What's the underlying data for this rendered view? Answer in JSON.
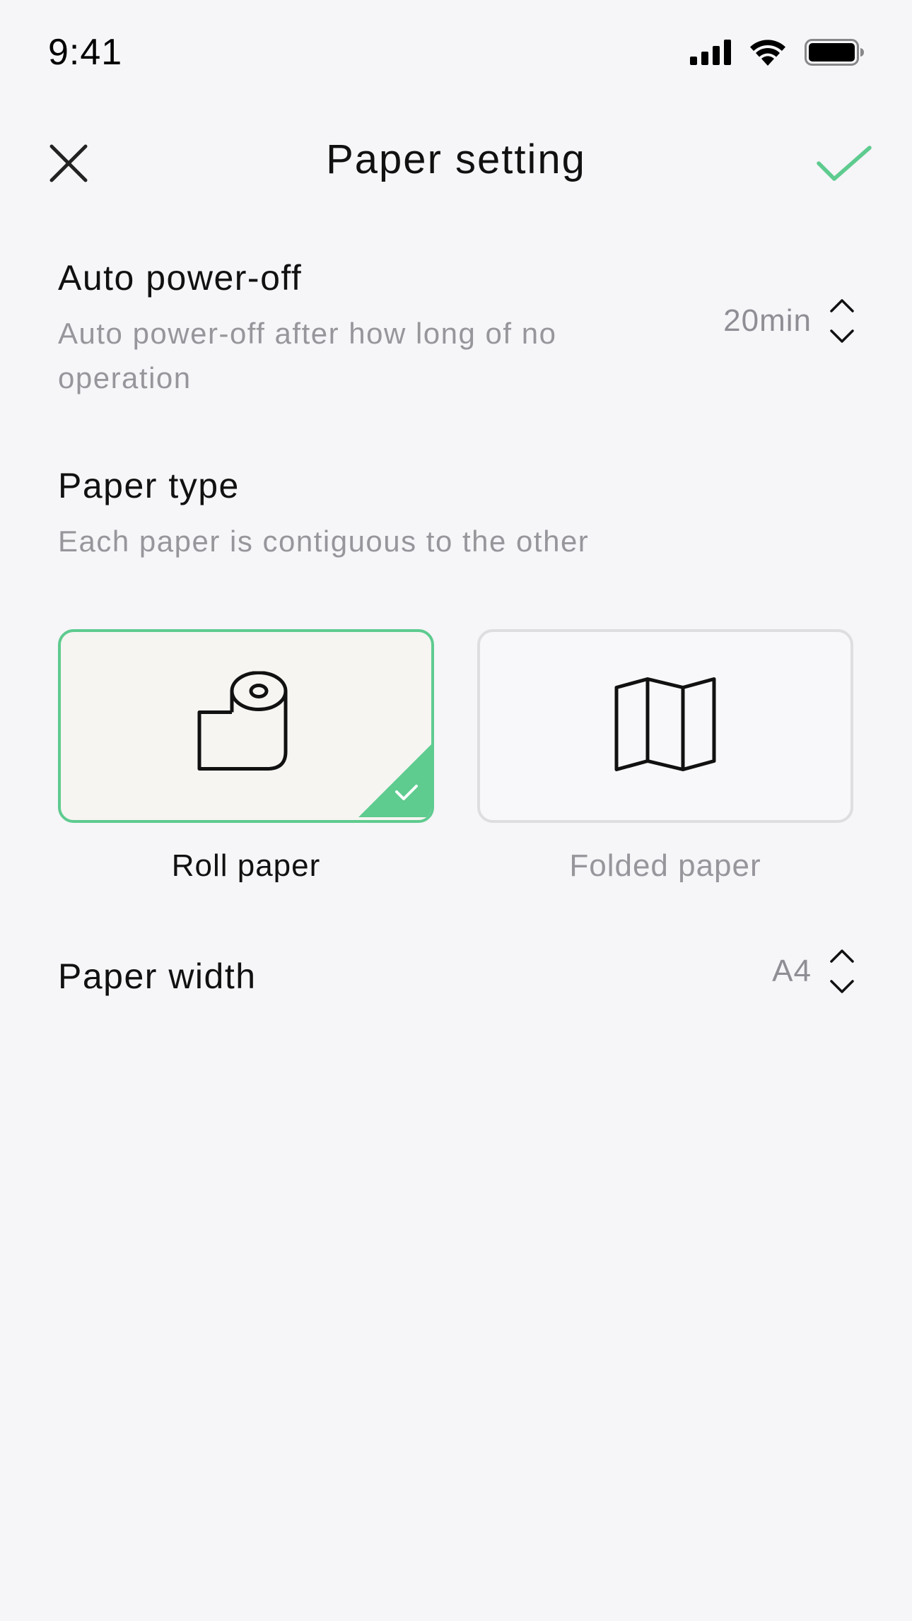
{
  "status_bar": {
    "time": "9:41",
    "icons": [
      "signal-icon",
      "wifi-icon",
      "battery-icon"
    ]
  },
  "nav": {
    "title": "Paper setting",
    "close_icon": "close-icon",
    "confirm_icon": "check-icon"
  },
  "auto_power_off": {
    "title": "Auto power-off",
    "description": "Auto power-off after how long of no operation",
    "value": "20min"
  },
  "paper_type": {
    "title": "Paper type",
    "description": "Each paper is contiguous to the other",
    "options": [
      {
        "label": "Roll paper",
        "icon": "roll-paper-icon",
        "selected": true
      },
      {
        "label": "Folded paper",
        "icon": "folded-paper-icon",
        "selected": false
      }
    ]
  },
  "paper_width": {
    "title": "Paper width",
    "value": "A4"
  },
  "colors": {
    "accent": "#5ecb8f",
    "background": "#f6f5f8",
    "secondary_text": "#97969b"
  }
}
